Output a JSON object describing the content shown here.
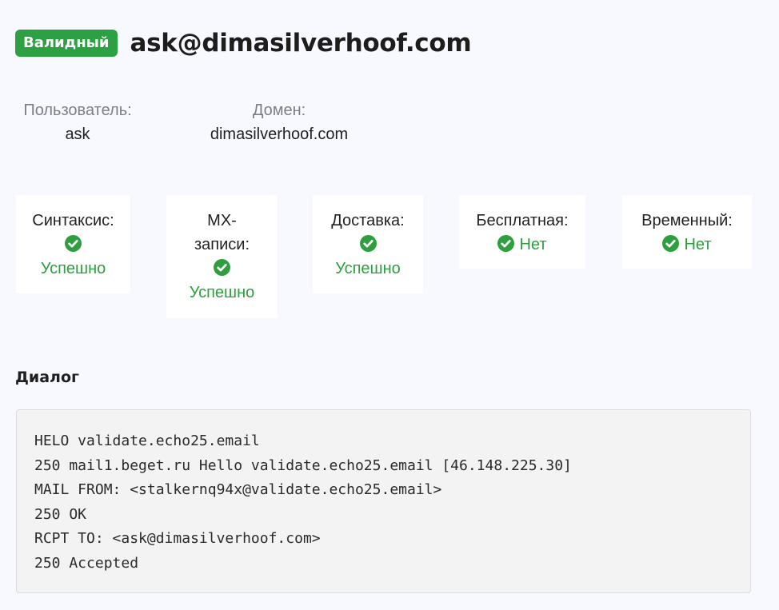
{
  "header": {
    "badge": "Валидный",
    "email": "ask@dimasilverhoof.com"
  },
  "fields": {
    "user_label": "Пользователь:",
    "user_value": "ask",
    "domain_label": "Домен:",
    "domain_value": "dimasilverhoof.com"
  },
  "checks": {
    "syntax": {
      "label": "Синтаксис:",
      "status": "Успешно"
    },
    "mx": {
      "label_line1": "MX-",
      "label_line2": "записи:",
      "status": "Успешно"
    },
    "delivery": {
      "label": "Доставка:",
      "status": "Успешно"
    },
    "free": {
      "label": "Бесплатная:",
      "status": "Нет"
    },
    "temporary": {
      "label": "Временный:",
      "status": "Нет"
    }
  },
  "dialog": {
    "title": "Диалог",
    "lines": [
      "HELO validate.echo25.email",
      "250 mail1.beget.ru Hello validate.echo25.email [46.148.225.30]",
      "MAIL FROM: <stalkernq94x@validate.echo25.email>",
      "250 OK",
      "RCPT TO: <ask@dimasilverhoof.com>",
      "250 Accepted"
    ]
  },
  "colors": {
    "badge_bg": "#2ca042",
    "success_green": "#2e9e3e",
    "page_bg": "#f8f9fe",
    "card_bg": "#ffffff",
    "dialog_bg": "#f3f3f3"
  },
  "icons": {
    "check": "check-circle-icon"
  }
}
